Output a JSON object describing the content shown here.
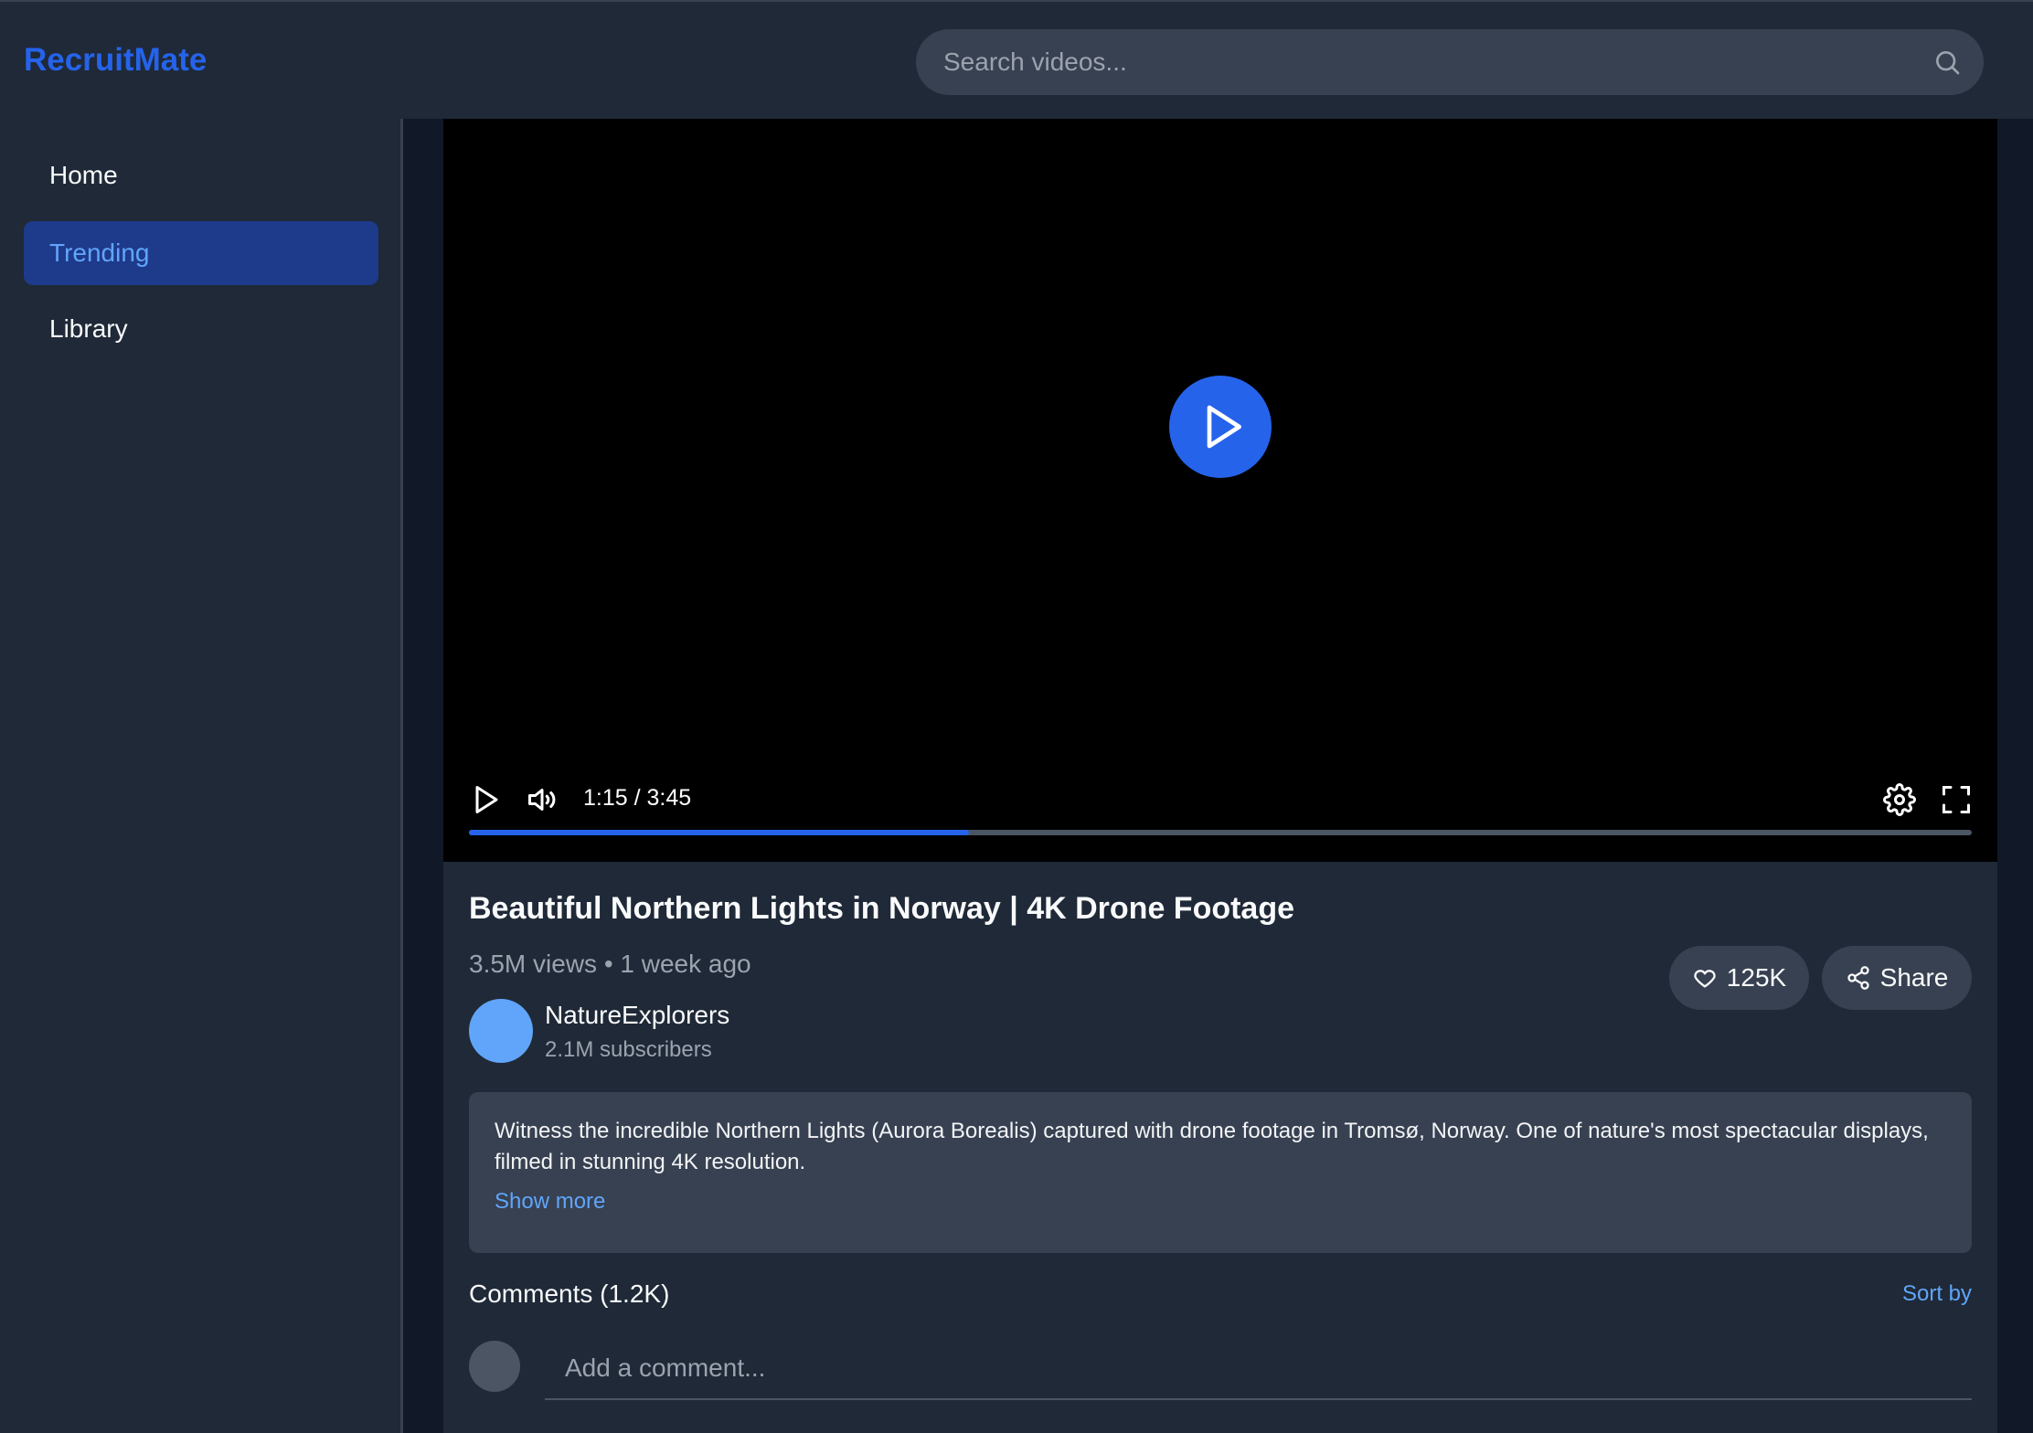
{
  "app": {
    "title": "RecruitMate"
  },
  "search": {
    "placeholder": "Search videos...",
    "icon": "search-icon"
  },
  "sidebar": {
    "items": [
      {
        "label": "Home",
        "active": false
      },
      {
        "label": "Trending",
        "active": true
      },
      {
        "label": "Library",
        "active": false
      }
    ]
  },
  "player": {
    "time": "1:15 / 3:45",
    "progress_fraction": 0.333,
    "accent": "#2563eb"
  },
  "video": {
    "title": "Beautiful Northern Lights in Norway | 4K Drone Footage",
    "meta": "3.5M views • 1 week ago",
    "likes": "125K",
    "share_label": "Share"
  },
  "channel": {
    "name": "NatureExplorers",
    "subscribers": "2.1M subscribers",
    "avatar_color": "#60a5fa"
  },
  "description": {
    "text": "Witness the incredible Northern Lights (Aurora Borealis) captured with drone footage in Tromsø, Norway. One of nature's most spectacular displays, filmed in stunning 4K resolution.",
    "show_more": "Show more"
  },
  "comments": {
    "title": "Comments (1.2K)",
    "sort_label": "Sort by",
    "placeholder": "Add a comment..."
  }
}
